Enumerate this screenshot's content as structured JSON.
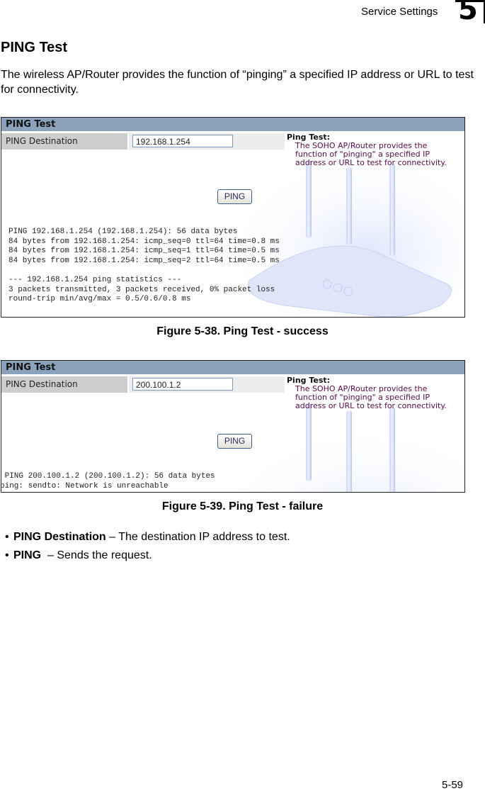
{
  "header": {
    "section": "Service Settings",
    "chapter": "5"
  },
  "title": "PING Test",
  "intro": "The wireless AP/Router provides the function of “pinging” a specified IP address or URL to test for connectivity.",
  "figures": [
    {
      "panel_title": "PING Test",
      "field_label": "PING Destination",
      "field_value": "192.168.1.254",
      "help_title": "Ping Test:",
      "help_lines": [
        "The SOHO AP/Router provides the",
        "function of \"pinging\" a specified IP",
        "address or URL to test for connectivity."
      ],
      "button": "PING",
      "output": "PING 192.168.1.254 (192.168.1.254): 56 data bytes\n84 bytes from 192.168.1.254: icmp_seq=0 ttl=64 time=0.8 ms\n84 bytes from 192.168.1.254: icmp_seq=1 ttl=64 time=0.5 ms\n84 bytes from 192.168.1.254: icmp_seq=2 ttl=64 time=0.5 ms\n\n--- 192.168.1.254 ping statistics ---\n3 packets transmitted, 3 packets received, 0% packet loss\nround-trip min/avg/max = 0.5/0.6/0.8 ms",
      "caption": "Figure 5-38.   Ping Test - success"
    },
    {
      "panel_title": "PING Test",
      "field_label": "PING Destination",
      "field_value": "200.100.1.2",
      "help_title": "Ping Test:",
      "help_lines": [
        "The SOHO AP/Router provides the",
        "function of \"pinging\" a specified IP",
        "address or URL to test for connectivity."
      ],
      "button": "PING",
      "output": " PING 200.100.1.2 (200.100.1.2): 56 data bytes\nping: sendto: Network is unreachable",
      "caption": "Figure 5-39.   Ping Test - failure"
    }
  ],
  "bullets": [
    {
      "term": "PING Destination",
      "desc": " – The destination IP address to test."
    },
    {
      "term": "PING ",
      "desc": " – Sends the request."
    }
  ],
  "footer": {
    "page": "5-59"
  }
}
